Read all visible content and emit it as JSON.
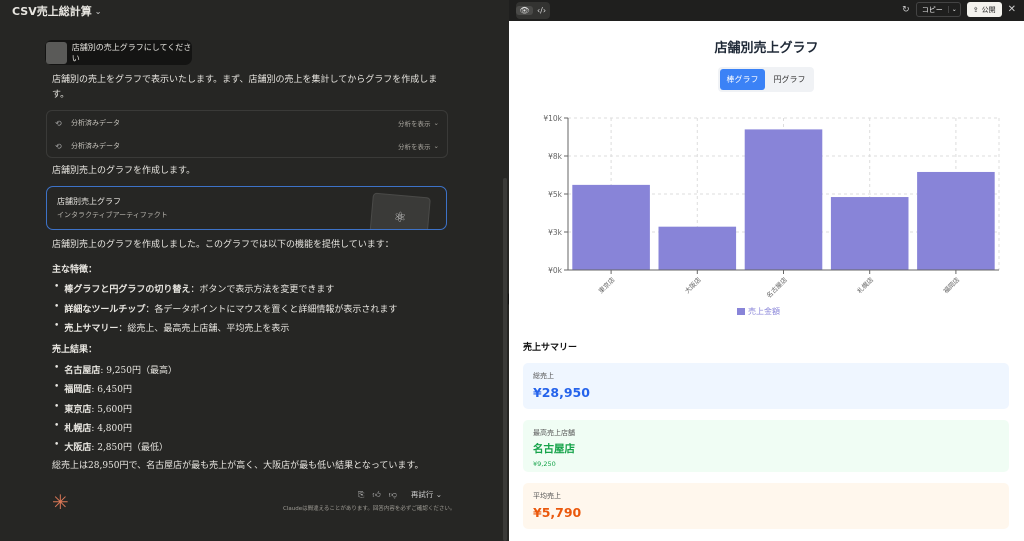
{
  "chat": {
    "title": "CSV売上総計算",
    "user_message": "店舗別の売上グラフにしてください",
    "intro": "店舗別の売上をグラフで表示いたします。まず、店舗別の売上を集計してからグラフを作成しま",
    "intro_cont": "す。",
    "tools": [
      {
        "label": "分析済みデータ",
        "action": "分析を表示"
      },
      {
        "label": "分析済みデータ",
        "action": "分析を表示"
      }
    ],
    "creating": "店舗別売上のグラフを作成します。",
    "artifact": {
      "title": "店舗別売上グラフ",
      "subtitle": "インタラクティブアーティファクト"
    },
    "done": "店舗別売上のグラフを作成しました。このグラフでは以下の機能を提供しています：",
    "features_head": "主な特徴：",
    "features": [
      {
        "bold": "棒グラフと円グラフの切り替え",
        "rest": "：ボタンで表示方法を変更できます"
      },
      {
        "bold": "詳細なツールチップ",
        "rest": "：各データポイントにマウスを置くと詳細情報が表示されます"
      },
      {
        "bold": "売上サマリー",
        "rest": "：総売上、最高売上店舗、平均売上を表示"
      }
    ],
    "results_head": "売上結果：",
    "results": [
      {
        "bold": "名古屋店",
        "rest": ": 9,250円（最高）"
      },
      {
        "bold": "福岡店",
        "rest": ": 6,450円"
      },
      {
        "bold": "東京店",
        "rest": ": 5,600円"
      },
      {
        "bold": "札幌店",
        "rest": ": 4,800円"
      },
      {
        "bold": "大阪店",
        "rest": ": 2,850円（最低）"
      }
    ],
    "conclusion": "総売上は28,950円で、名古屋店が最も売上が高く、大阪店が最も低い結果となっています。",
    "retry_label": "再試行",
    "disclaimer": "Claudeは間違えることがあります。回答内容を必ずご確認ください。"
  },
  "panel": {
    "copy_label": "コピー",
    "publish_label": "公開"
  },
  "page": {
    "title": "店舗別売上グラフ",
    "tabs": [
      "棒グラフ",
      "円グラフ"
    ],
    "summary_title": "売上サマリー",
    "cards": {
      "total_label": "総売上",
      "total_value": "¥28,950",
      "top_label": "最高売上店舗",
      "top_value": "名古屋店",
      "top_sub": "¥9,250",
      "avg_label": "平均売上",
      "avg_value": "¥5,790"
    }
  },
  "colors": {
    "bar": "#8884d8",
    "accent": "#3b82f6"
  },
  "chart_data": {
    "type": "bar",
    "categories": [
      "東京店",
      "大阪店",
      "名古屋店",
      "札幌店",
      "福岡店"
    ],
    "series": [
      {
        "name": "売上金額",
        "values": [
          5600,
          2850,
          9250,
          4800,
          6450
        ]
      }
    ],
    "ylim": [
      0,
      10000
    ],
    "yticks": [
      0,
      2500,
      5000,
      7500,
      10000
    ],
    "ytick_labels": [
      "¥0k",
      "¥3k",
      "¥5k",
      "¥8k",
      "¥10k"
    ],
    "grid": true,
    "legend": "bottom"
  }
}
